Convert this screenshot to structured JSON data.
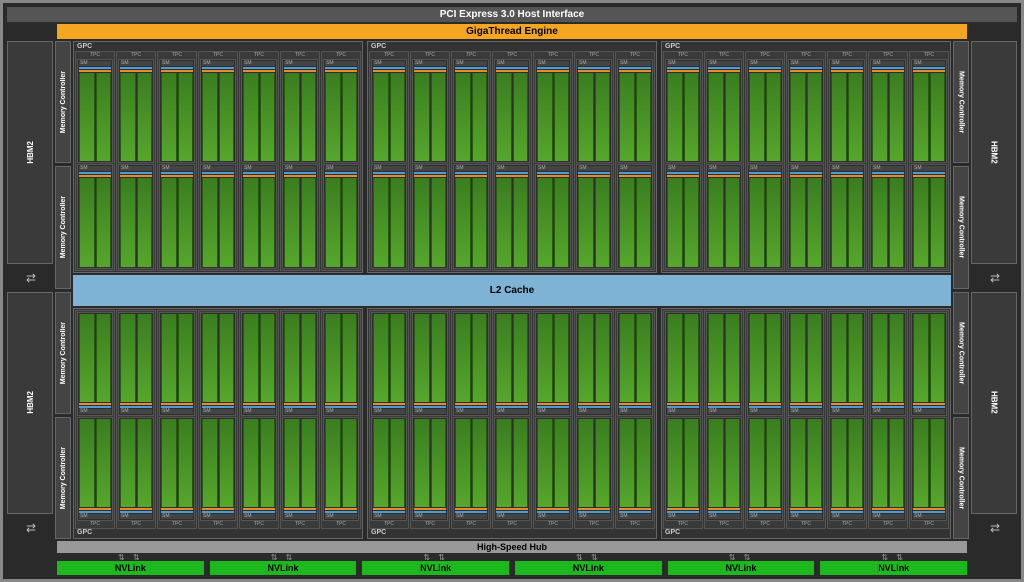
{
  "pcie_label": "PCI Express 3.0 Host Interface",
  "gigathread_label": "GigaThread Engine",
  "l2_label": "L2 Cache",
  "hub_label": "High-Speed Hub",
  "hbm_label": "HBM2",
  "mc_label": "Memory Controller",
  "gpc_label": "GPC",
  "tpc_label": "TPC",
  "sm_label": "SM",
  "nvlink_label": "NVLink",
  "counts": {
    "gpc_rows": 2,
    "gpcs_per_row": 3,
    "tpcs_per_gpc": 7,
    "sms_per_tpc": 2,
    "nvlinks": 6,
    "hbm_per_side": 2,
    "mc_per_side": 4
  }
}
